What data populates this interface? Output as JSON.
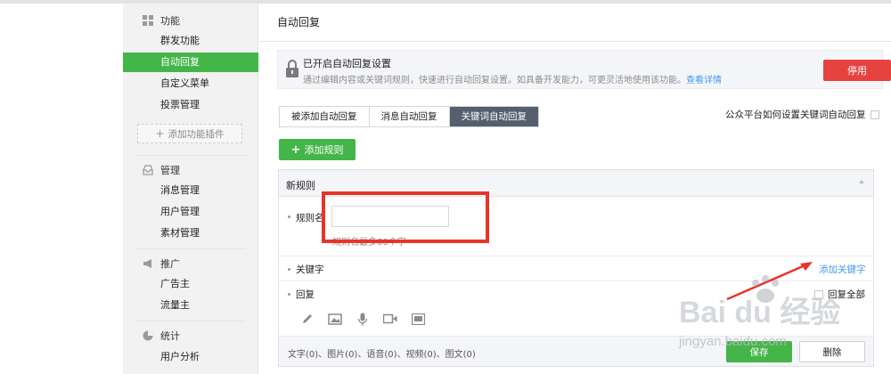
{
  "sidebar": {
    "groups": {
      "features": "功能",
      "management": "管理",
      "promotion": "推广",
      "statistics": "统计"
    },
    "items": {
      "mass_send": "群发功能",
      "auto_reply": "自动回复",
      "custom_menu": "自定义菜单",
      "voting": "投票管理",
      "add_plugin": "添加功能插件",
      "messages": "消息管理",
      "users": "用户管理",
      "materials": "素材管理",
      "advertiser": "广告主",
      "publisher": "流量主",
      "user_analysis": "用户分析"
    },
    "active_item": "auto_reply"
  },
  "main": {
    "title": "自动回复",
    "notice": {
      "title": "已开启自动回复设置",
      "description": "通过编辑内容或关键词规则，快速进行自动回复设置。如具备开发能力，可更灵活地使用该功能。",
      "link": "查看详情",
      "stop_button": "停用"
    },
    "tabs": [
      "被添加自动回复",
      "消息自动回复",
      "关键词自动回复"
    ],
    "active_tab": 2,
    "help_text": "公众平台如何设置关键词自动回复",
    "add_rule_button": "添加规则",
    "rule": {
      "header": "新规则",
      "name_label": "规则名",
      "name_value": "",
      "name_hint": "规则名最多60个字",
      "keyword_label": "关键字",
      "add_keyword_link": "添加关键字",
      "reply_label": "回复",
      "reply_all_label": "回复全部",
      "toolbar_icons": [
        "pencil-icon",
        "image-icon",
        "microphone-icon",
        "video-icon",
        "news-icon"
      ],
      "stats": "文字(0)、图片(0)、语音(0)、视频(0)、图文(0)",
      "save_button": "保存",
      "delete_button": "删除"
    }
  },
  "watermark": {
    "brand": "Bai du 经验",
    "url": "jingyan.baidu.com"
  },
  "colors": {
    "accent_green": "#44b549",
    "danger_red": "#e64340",
    "link_blue": "#459ae9",
    "tab_active": "#54606e",
    "annotation_red": "#e8342b"
  }
}
